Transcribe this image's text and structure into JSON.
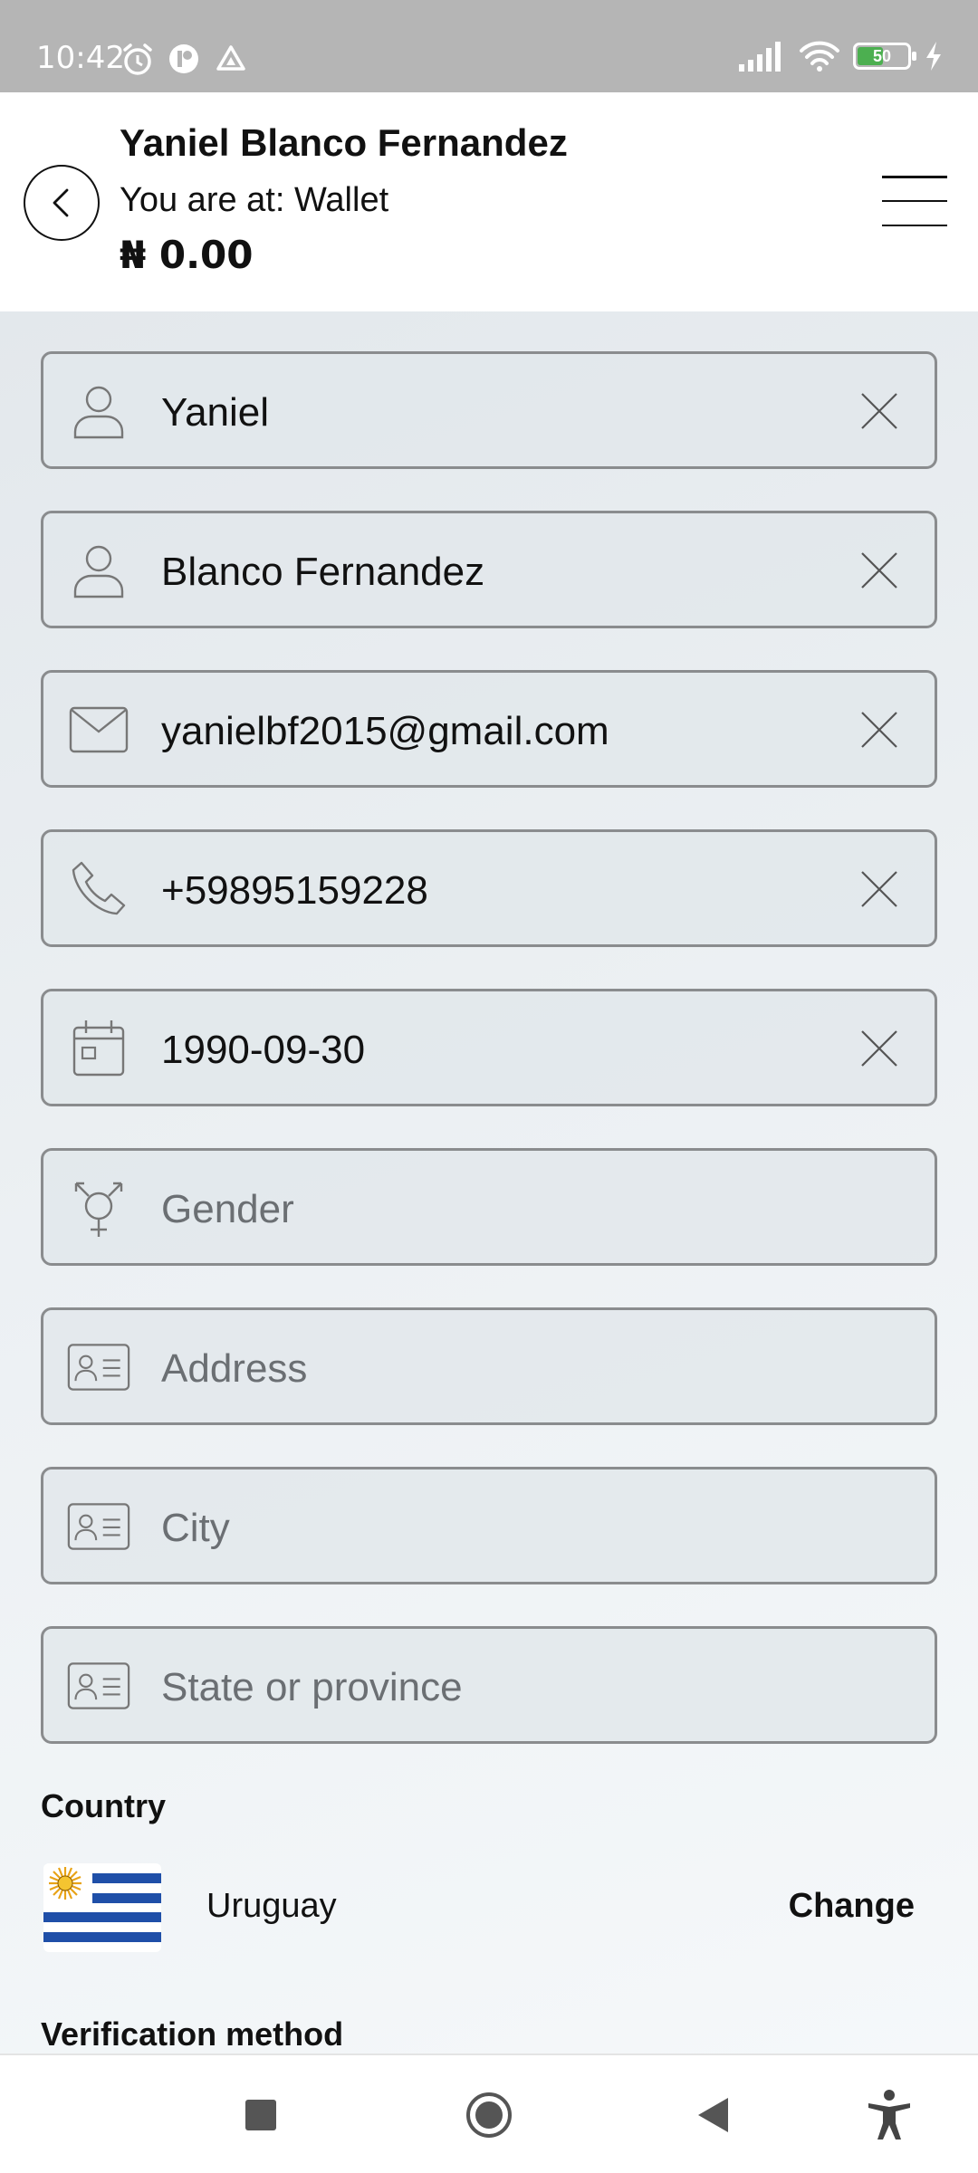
{
  "status_bar": {
    "time": "10:42",
    "battery": "50"
  },
  "header": {
    "name": "Yaniel Blanco Fernandez",
    "location": "You are at: Wallet",
    "balance": "₦ 0.00"
  },
  "form": {
    "first_name": {
      "value": "Yaniel",
      "icon": "person-icon"
    },
    "last_name": {
      "value": "Blanco Fernandez",
      "icon": "person-icon"
    },
    "email": {
      "value": "yanielbf2015@gmail.com",
      "icon": "mail-icon"
    },
    "phone": {
      "value": "+59895159228",
      "icon": "phone-icon"
    },
    "birth_date": {
      "value": "1990-09-30",
      "icon": "calendar-icon"
    },
    "gender": {
      "placeholder": "Gender",
      "icon": "gender-icon"
    },
    "address": {
      "placeholder": "Address",
      "icon": "id-card-icon"
    },
    "city": {
      "placeholder": "City",
      "icon": "id-card-icon"
    },
    "state": {
      "placeholder": "State or province",
      "icon": "id-card-icon"
    }
  },
  "country": {
    "label": "Country",
    "name": "Uruguay",
    "change_label": "Change",
    "flag_icon": "uruguay-flag-icon"
  },
  "verification": {
    "label": "Verification method"
  },
  "colors": {
    "status_bar": "#b5b5b5",
    "field_border": "#8a8c8e",
    "field_bg": "#e2e7eb",
    "text": "#111111",
    "placeholder": "#6b6f73"
  }
}
